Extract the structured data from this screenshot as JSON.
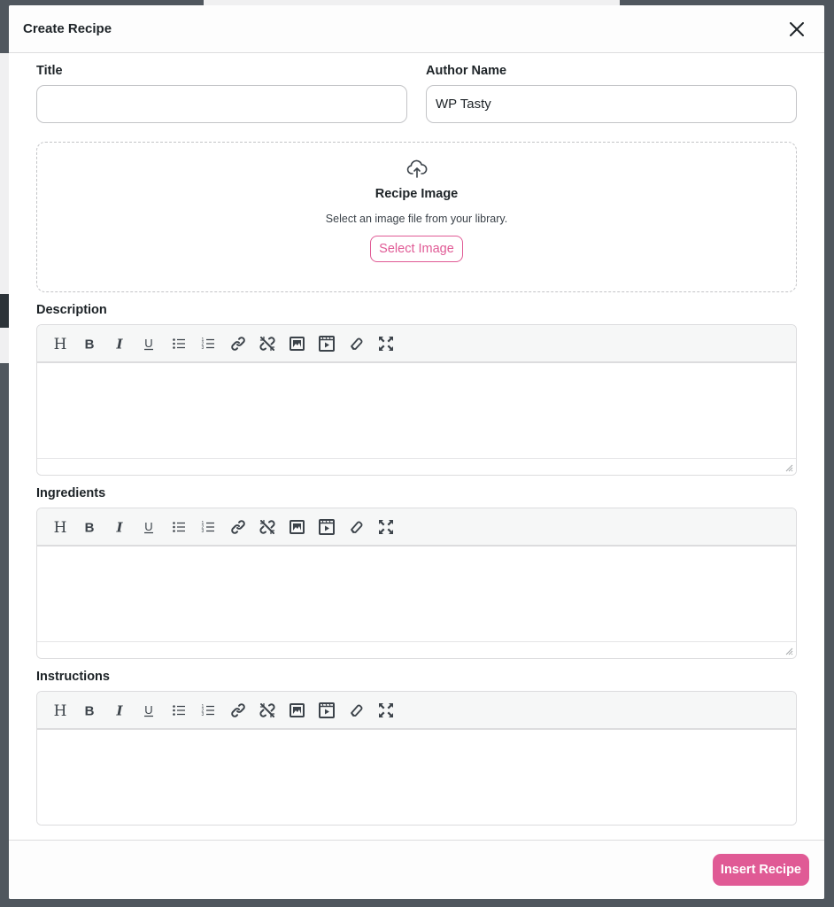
{
  "modal": {
    "title": "Create Recipe",
    "close_icon": "close-icon"
  },
  "fields": {
    "title": {
      "label": "Title",
      "value": "",
      "placeholder": ""
    },
    "author": {
      "label": "Author Name",
      "value": "WP Tasty",
      "placeholder": ""
    }
  },
  "image_upload": {
    "icon": "cloud-upload-icon",
    "title": "Recipe Image",
    "subtitle": "Select an image file from your library.",
    "button_label": "Select Image"
  },
  "editors": {
    "description": {
      "label": "Description"
    },
    "ingredients": {
      "label": "Ingredients"
    },
    "instructions": {
      "label": "Instructions"
    }
  },
  "toolbar_icons": [
    "heading-icon",
    "bold-icon",
    "italic-icon",
    "underline-icon",
    "bullet-list-icon",
    "numbered-list-icon",
    "link-icon",
    "unlink-icon",
    "image-icon",
    "video-icon",
    "eraser-icon",
    "fullscreen-icon"
  ],
  "footer": {
    "insert_label": "Insert Recipe"
  },
  "colors": {
    "accent": "#e05a95"
  }
}
